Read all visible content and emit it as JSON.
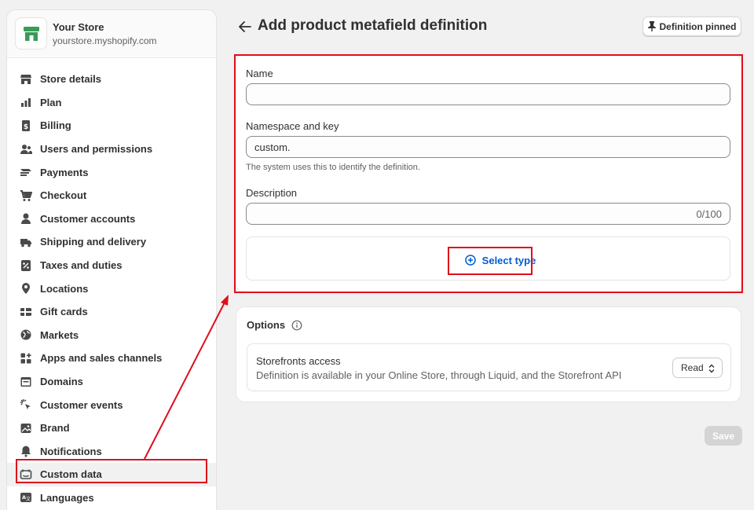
{
  "store": {
    "name": "Your Store",
    "url": "yourstore.myshopify.com"
  },
  "sidebar": {
    "items": [
      {
        "label": "Store details",
        "icon": "storefront-icon"
      },
      {
        "label": "Plan",
        "icon": "plan-icon"
      },
      {
        "label": "Billing",
        "icon": "billing-icon"
      },
      {
        "label": "Users and permissions",
        "icon": "users-icon"
      },
      {
        "label": "Payments",
        "icon": "payments-icon"
      },
      {
        "label": "Checkout",
        "icon": "cart-icon"
      },
      {
        "label": "Customer accounts",
        "icon": "person-icon"
      },
      {
        "label": "Shipping and delivery",
        "icon": "truck-icon"
      },
      {
        "label": "Taxes and duties",
        "icon": "tax-icon"
      },
      {
        "label": "Locations",
        "icon": "location-pin-icon"
      },
      {
        "label": "Gift cards",
        "icon": "gift-card-icon"
      },
      {
        "label": "Markets",
        "icon": "globe-icon"
      },
      {
        "label": "Apps and sales channels",
        "icon": "apps-icon"
      },
      {
        "label": "Domains",
        "icon": "domain-icon"
      },
      {
        "label": "Customer events",
        "icon": "cursor-click-icon"
      },
      {
        "label": "Brand",
        "icon": "brand-icon"
      },
      {
        "label": "Notifications",
        "icon": "bell-icon"
      },
      {
        "label": "Custom data",
        "icon": "custom-data-icon"
      },
      {
        "label": "Languages",
        "icon": "language-icon"
      }
    ],
    "active": "Custom data"
  },
  "header": {
    "title": "Add product metafield definition",
    "pin_label": "Definition pinned"
  },
  "form": {
    "name_label": "Name",
    "name_value": "",
    "namespace_label": "Namespace and key",
    "namespace_value": "custom.",
    "namespace_help": "The system uses this to identify the definition.",
    "description_label": "Description",
    "description_value": "",
    "description_counter": "0/100",
    "select_type_label": "Select type"
  },
  "options": {
    "title": "Options",
    "storefronts_title": "Storefronts access",
    "storefronts_desc": "Definition is available in your Online Store, through Liquid, and the Storefront API",
    "access_value": "Read"
  },
  "footer": {
    "save_label": "Save"
  },
  "colors": {
    "accent": "#005bd3",
    "annotation": "#e00d1c",
    "store_logo": "#3a9b55"
  }
}
